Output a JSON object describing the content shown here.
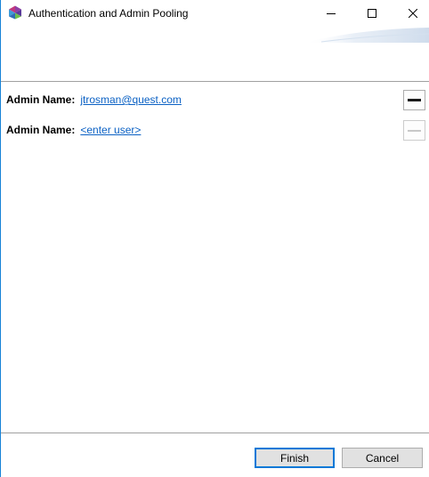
{
  "window": {
    "title": "Authentication and Admin Pooling",
    "controls": [
      "minimize-icon",
      "maximize-icon",
      "close-icon"
    ]
  },
  "admins": [
    {
      "label": "Admin Name:",
      "value": "jtrosman@quest.com",
      "remove_enabled": true
    },
    {
      "label": "Admin Name:",
      "value": "<enter user>",
      "remove_enabled": false
    }
  ],
  "footer": {
    "finish_label": "Finish",
    "cancel_label": "Cancel"
  },
  "colors": {
    "link": "#0b61c4",
    "accent_border": "#0078d7",
    "window_border": "#1883d7",
    "button_face": "#e1e1e1"
  }
}
